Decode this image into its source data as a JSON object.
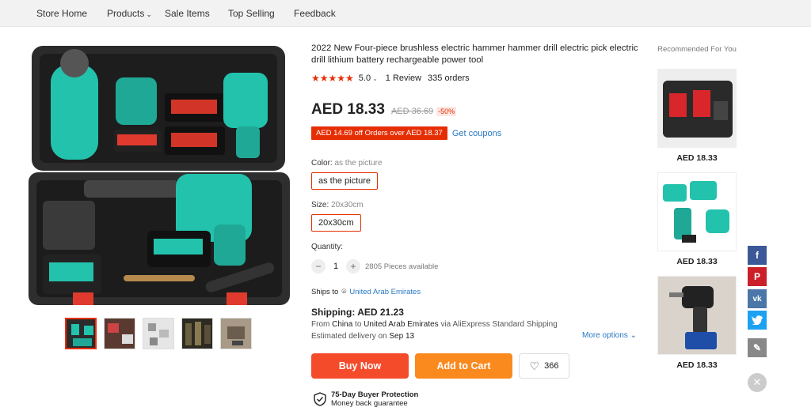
{
  "nav": {
    "items": [
      "Store Home",
      "Products",
      "Sale Items",
      "Top Selling",
      "Feedback"
    ]
  },
  "product": {
    "title": "2022 New Four-piece brushless electric hammer hammer drill electric pick electric drill lithium battery rechargeable power tool",
    "stars": "★★★★★",
    "rating": "5.0",
    "reviews": "1 Review",
    "orders": "335 orders",
    "price": "AED 18.33",
    "original_price": "AED 36.69",
    "discount": "-50%",
    "coupon_badge": "AED 14.69 off Orders over AED 18.37",
    "get_coupons": "Get coupons",
    "color_label": "Color:",
    "color_value": "as the picture",
    "color_option": "as the picture",
    "size_label": "Size:",
    "size_value": "20x30cm",
    "size_option": "20x30cm",
    "quantity_label": "Quantity:",
    "quantity": "1",
    "pieces_available": "2805 Pieces available",
    "ships_to_label": "Ships to",
    "ships_to": "United Arab Emirates",
    "shipping_title": "Shipping: AED 21.23",
    "shipping_from_prefix": "From",
    "shipping_from": "China",
    "shipping_to_word": "to",
    "shipping_dest": "United Arab Emirates",
    "shipping_via": "via AliExpress Standard Shipping",
    "delivery_prefix": "Estimated delivery on",
    "delivery_date": "Sep 13",
    "more_options": "More options",
    "buy_now": "Buy Now",
    "add_to_cart": "Add to Cart",
    "wishlist_count": "366",
    "protection_title": "75-Day Buyer Protection",
    "protection_sub": "Money back guarantee"
  },
  "recommended": {
    "title": "Recommended For You",
    "items": [
      {
        "price": "AED 18.33"
      },
      {
        "price": "AED 18.33"
      },
      {
        "price": "AED 18.33"
      }
    ]
  },
  "share": {
    "icons": [
      "facebook-icon",
      "pinterest-icon",
      "vk-icon",
      "twitter-icon",
      "edit-icon"
    ],
    "colors": {
      "facebook": "#3b5998",
      "pinterest": "#cb2027",
      "vk": "#4a76a8",
      "twitter": "#1da1f2",
      "edit": "#888888"
    }
  },
  "colors": {
    "accent": "#e62e04",
    "buy": "#f44b2b",
    "cart": "#fa8a1e",
    "link": "#2878c3"
  }
}
